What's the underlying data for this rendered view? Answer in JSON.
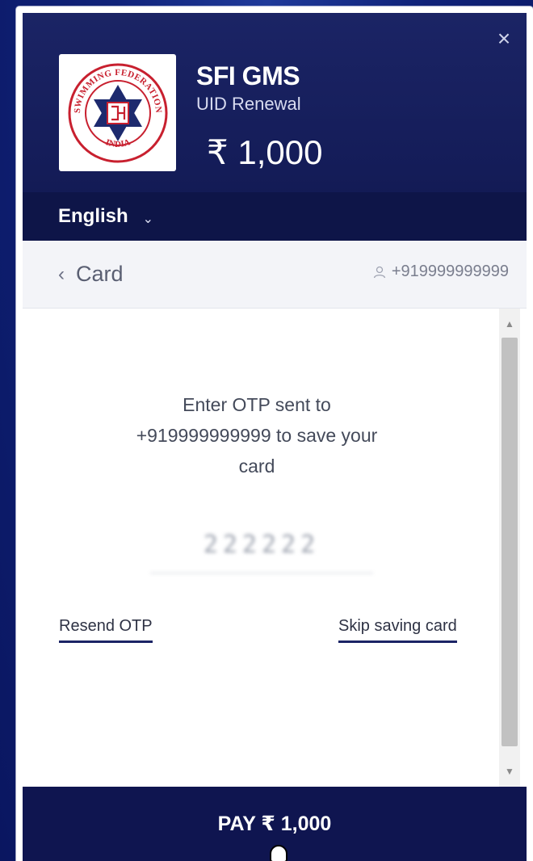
{
  "header": {
    "close_symbol": "×",
    "merchant_name": "SFI GMS",
    "merchant_description": "UID Renewal",
    "amount": "₹ 1,000",
    "logo": {
      "ring_text_top": "SWIMMING FEDERATION",
      "ring_text_bottom": "INDIA",
      "colors": {
        "ring": "#c8202f",
        "star": "#1d2a6e"
      }
    },
    "language": {
      "selected": "English"
    }
  },
  "subbar": {
    "back_label": "Card",
    "contact": "+919999999999"
  },
  "otp": {
    "message_line1": "Enter OTP sent to",
    "message_line2": "+919999999999 to save your",
    "message_line3": "card",
    "value": "222222",
    "resend_label": "Resend OTP",
    "skip_label": "Skip saving card"
  },
  "footer": {
    "pay_label": "PAY ₹ 1,000"
  },
  "colors": {
    "primary": "#141c58",
    "accent_underline": "#1b2465",
    "background": "#10237a"
  }
}
